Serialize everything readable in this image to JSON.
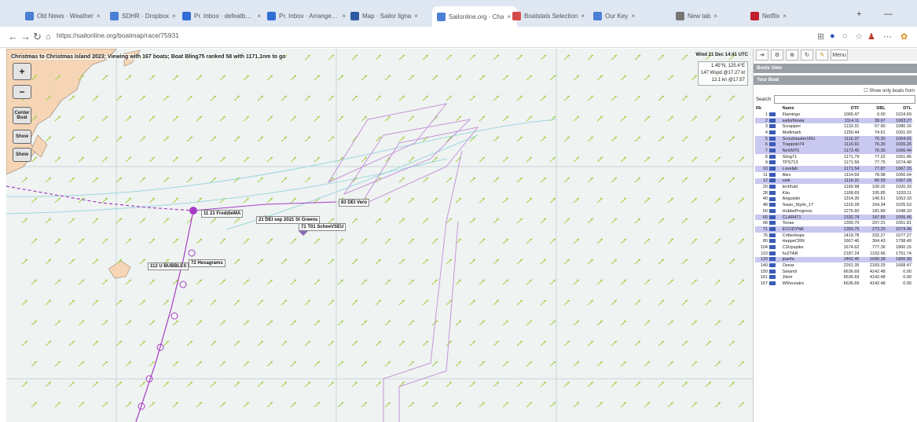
{
  "browser": {
    "tabs": [
      {
        "title": "Old News · Weather",
        "fav": "#4a7fd4"
      },
      {
        "title": "SDHR · Dropbox",
        "fav": "#4a7fd4"
      },
      {
        "title": "Pr. Inbox · defeatbuccs",
        "fav": "#2f6fd6"
      },
      {
        "title": "Pr. Inbox · Arranger · defeat u",
        "fav": "#2f6fd6"
      },
      {
        "title": "Map · Sailor ligna",
        "fav": "#2d5aa0"
      },
      {
        "title": "Sailonline.org · Cha",
        "fav": "#4a7fd4"
      },
      {
        "title": "Boatstats Selection",
        "fav": "#d44a4a"
      },
      {
        "title": "Our Key",
        "fav": "#4a7fd4"
      },
      {
        "title": "New tab",
        "fav": "#777777"
      },
      {
        "title": "Netflix",
        "fav": "#c0202a"
      }
    ],
    "url": "https://sailonline.org/boatmap/race/75931",
    "nav": {
      "back": "←",
      "forward": "→",
      "reload": "↻",
      "home": "⌂"
    },
    "window_controls": {
      "minimize": "—",
      "add_tab": "+",
      "menu": "⋯"
    }
  },
  "map": {
    "status_line": "Christmas to Christmas Island 2023; Viewing with 167 boats; Boat Bling75 ranked 58 with 1171.1nm to go",
    "zoom_in": "+",
    "zoom_out": "−",
    "btn_center": "Center Boat",
    "btn_3": "Show",
    "btn_4": "Show",
    "wind_header": "Wind 21 Dec 14:41 UTC",
    "wind_line1": "1.45°N, 125.4°E",
    "wind_line2": "147 Wspd @17.27 kt",
    "wind_line3": "12.1 kn @17.57",
    "labels": {
      "boat_main": "11 21 FreddieMA",
      "boat_a": "83 DEI Vero",
      "boat_b": "21 DEI sep 2021 St Greens",
      "boat_c": "71 T01 ScheeVSEU",
      "boat_d": "72 Hexagrams",
      "boat_e": "112 U BUBBLES"
    },
    "colors": {
      "sea": "#eff3f2",
      "land": "#f5d5b5",
      "wind_arrow": "#a7d14a",
      "track": "#a63cc4"
    }
  },
  "panel": {
    "toolbar_icons": [
      "arrow-icon",
      "settings-icon",
      "zoom-icon",
      "reload-icon",
      "pencil-icon"
    ],
    "toolbar_last": "Menu",
    "section1": "Boats View",
    "section2": "Your Boat",
    "show_only_label": "Show only boats from",
    "search_label": "Search",
    "headers": [
      "Rk",
      "",
      "Name",
      "DTF",
      "DBL",
      "DTL"
    ],
    "rows": [
      {
        "rk": "1",
        "name": "Flamingo",
        "dtf": "1065.47",
        "dbl": "0.00",
        "dtl": "1024.69",
        "hl": false
      },
      {
        "rk": "2",
        "name": "sailorfirewa",
        "dtf": "1114.11",
        "dbl": "38.67",
        "dtl": "1063.27",
        "hl": true
      },
      {
        "rk": "3",
        "name": "Scrapiper",
        "dtf": "1133.31",
        "dbl": "57.90",
        "dtl": "1080.16",
        "hl": false
      },
      {
        "rk": "4",
        "name": "Mutlimark",
        "dtf": "1150.44",
        "dbl": "74.61",
        "dtl": "1091.93",
        "hl": false
      },
      {
        "rk": "5",
        "name": "Scoutmaster1RU",
        "dtf": "1116.37",
        "dbl": "76.30",
        "dtl": "1064.91",
        "hl": true
      },
      {
        "rk": "6",
        "name": "Trappolo74",
        "dtf": "1116.91",
        "dbl": "76.30",
        "dtl": "1065.26",
        "hl": true
      },
      {
        "rk": "7",
        "name": "NeSM75",
        "dtf": "1173.45",
        "dbl": "76.30",
        "dtl": "1066.44",
        "hl": true
      },
      {
        "rk": "8",
        "name": "Sling71",
        "dtf": "1171.79",
        "dbl": "77.22",
        "dtl": "1091.86",
        "hl": false
      },
      {
        "rk": "9",
        "name": "TPS713",
        "dtf": "1171.56",
        "dbl": "77.75",
        "dtl": "1074.48",
        "hl": false
      },
      {
        "rk": "10",
        "name": "Lovelab",
        "dtf": "1171.54",
        "dbl": "77.87",
        "dtl": "1067.15",
        "hl": true
      },
      {
        "rk": "11",
        "name": "Alex",
        "dtf": "1114.69",
        "dbl": "78.98",
        "dtl": "1066.64",
        "hl": false
      },
      {
        "rk": "12",
        "name": "vale",
        "dtf": "1116.31",
        "dbl": "80.93",
        "dtl": "1067.26",
        "hl": true
      },
      {
        "rk": "20",
        "name": "techfuld",
        "dtf": "1169.98",
        "dbl": "100.02",
        "dtl": "1020.33",
        "hl": false
      },
      {
        "rk": "28",
        "name": "Kitu",
        "dtf": "1168.69",
        "dbl": "105.85",
        "dtl": "1033.11",
        "hl": false
      },
      {
        "rk": "40",
        "name": "Anguistin",
        "dtf": "1314.35",
        "dbl": "140.51",
        "dtl": "1063.33",
        "hl": false
      },
      {
        "rk": "48",
        "name": "Swan_Stylin_17",
        "dtf": "1319.28",
        "dbl": "164.34",
        "dtl": "1025.53",
        "hl": false
      },
      {
        "rk": "50",
        "name": "HubbsProgress",
        "dtf": "1276.60",
        "dbl": "181.89",
        "dtl": "1048.33",
        "hl": false
      },
      {
        "rk": "60",
        "name": "CLAR471",
        "dtf": "1332.78",
        "dbl": "187.89",
        "dtl": "1055.45",
        "hl": true
      },
      {
        "rk": "68",
        "name": "Tonas",
        "dtf": "1300.70",
        "dbl": "207.31",
        "dtl": "1061.81",
        "hl": false
      },
      {
        "rk": "71",
        "name": "ECODYNA",
        "dtf": "1350.75",
        "dbl": "273.20",
        "dtl": "1074.45",
        "hl": true
      },
      {
        "rk": "76",
        "name": "CritterHope",
        "dtf": "1419.78",
        "dbl": "332.27",
        "dtl": "1077.27",
        "hl": false
      },
      {
        "rk": "80",
        "name": "HeppeCRN",
        "dtf": "1667.46",
        "dbl": "364.43",
        "dtl": "1798.49",
        "hl": false
      },
      {
        "rk": "104",
        "name": "C3Upspike",
        "dtf": "1674.62",
        "dbl": "777.36",
        "dtl": "1860.15",
        "hl": false
      },
      {
        "rk": "110",
        "name": "hu2TAR",
        "dtf": "2187.24",
        "dbl": "1102.66",
        "dtl": "1751.74",
        "hl": false
      },
      {
        "rk": "120",
        "name": "jeanfa",
        "dtf": "1462.40",
        "dbl": "1090.38",
        "dtl": "1800.90",
        "hl": true
      },
      {
        "rk": "140",
        "name": "Ozear",
        "dtf": "2261.35",
        "dbl": "2183.25",
        "dtl": "1668.47",
        "hl": false
      },
      {
        "rk": "150",
        "name": "Setamil",
        "dtf": "6636.69",
        "dbl": "4142.48",
        "dtl": "0.00",
        "hl": false
      },
      {
        "rk": "161",
        "name": "Jilem",
        "dtf": "6636.69",
        "dbl": "4142.48",
        "dtl": "0.00",
        "hl": false
      },
      {
        "rk": "167",
        "name": "WReceatro",
        "dtf": "6636.69",
        "dbl": "4142.48",
        "dtl": "0.00",
        "hl": false
      }
    ]
  }
}
